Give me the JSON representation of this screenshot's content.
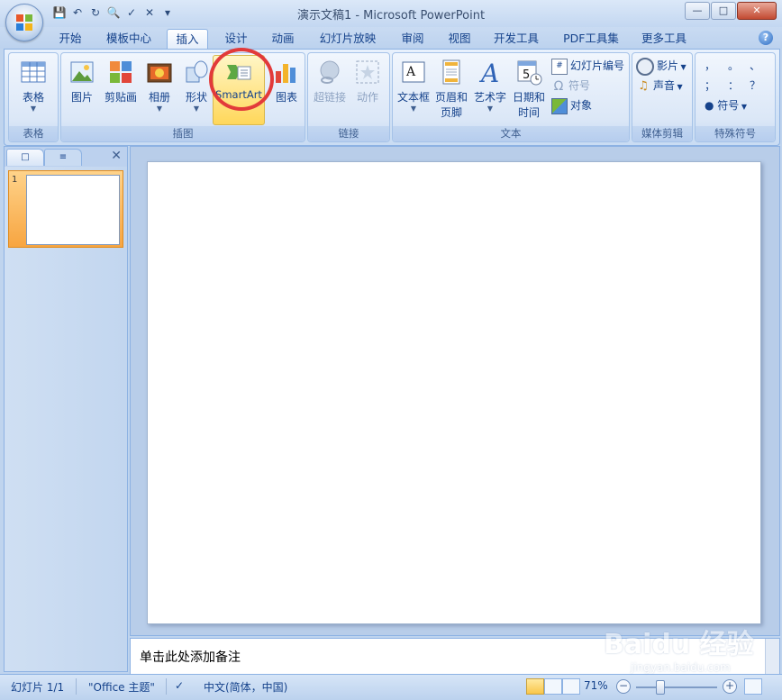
{
  "window": {
    "title": "演示文稿1 - Microsoft PowerPoint"
  },
  "tabs": [
    {
      "label": "开始"
    },
    {
      "label": "模板中心"
    },
    {
      "label": "插入"
    },
    {
      "label": "设计"
    },
    {
      "label": "动画"
    },
    {
      "label": "幻灯片放映"
    },
    {
      "label": "审阅"
    },
    {
      "label": "视图"
    },
    {
      "label": "开发工具"
    },
    {
      "label": "PDF工具集"
    },
    {
      "label": "更多工具"
    }
  ],
  "active_tab": "插入",
  "ribbon": {
    "table_group": {
      "label": "表格",
      "table_button": "表格"
    },
    "illustrations_group": {
      "label": "插图",
      "picture": "图片",
      "clipart": "剪贴画",
      "album": "相册",
      "shapes": "形状",
      "smartart": "SmartArt",
      "chart": "图表"
    },
    "links_group": {
      "label": "链接",
      "hyperlink": "超链接",
      "action": "动作"
    },
    "text_group": {
      "label": "文本",
      "textbox": "文本框",
      "header_footer_1": "页眉和",
      "header_footer_2": "页脚",
      "wordart": "艺术字",
      "datetime_1": "日期和",
      "datetime_2": "时间",
      "slide_number": "幻灯片编号",
      "symbol": "符号",
      "object": "对象",
      "calendar_day": "5"
    },
    "media_group": {
      "label": "媒体剪辑",
      "movie": "影片",
      "sound": "声音"
    },
    "special_symbols_group": {
      "label": "特殊符号",
      "punct_row1": [
        "，",
        "。",
        "、"
      ],
      "punct_row2": [
        "；",
        "：",
        "？"
      ],
      "symbol_button": "符号"
    }
  },
  "slides_pane": {
    "slide_number": "1"
  },
  "notes": {
    "placeholder": "单击此处添加备注"
  },
  "statusbar": {
    "slide_info": "幻灯片 1/1",
    "theme": "\"Office 主题\"",
    "language": "中文(简体，中国)",
    "zoom": "71%"
  },
  "watermark": {
    "brand": "Baidu 经验",
    "url": "jingyan.baidu.com"
  },
  "colors": {
    "accent_highlight": "#ffd75a",
    "annotation_circle": "#e23a3a",
    "ribbon_text": "#15428b"
  }
}
